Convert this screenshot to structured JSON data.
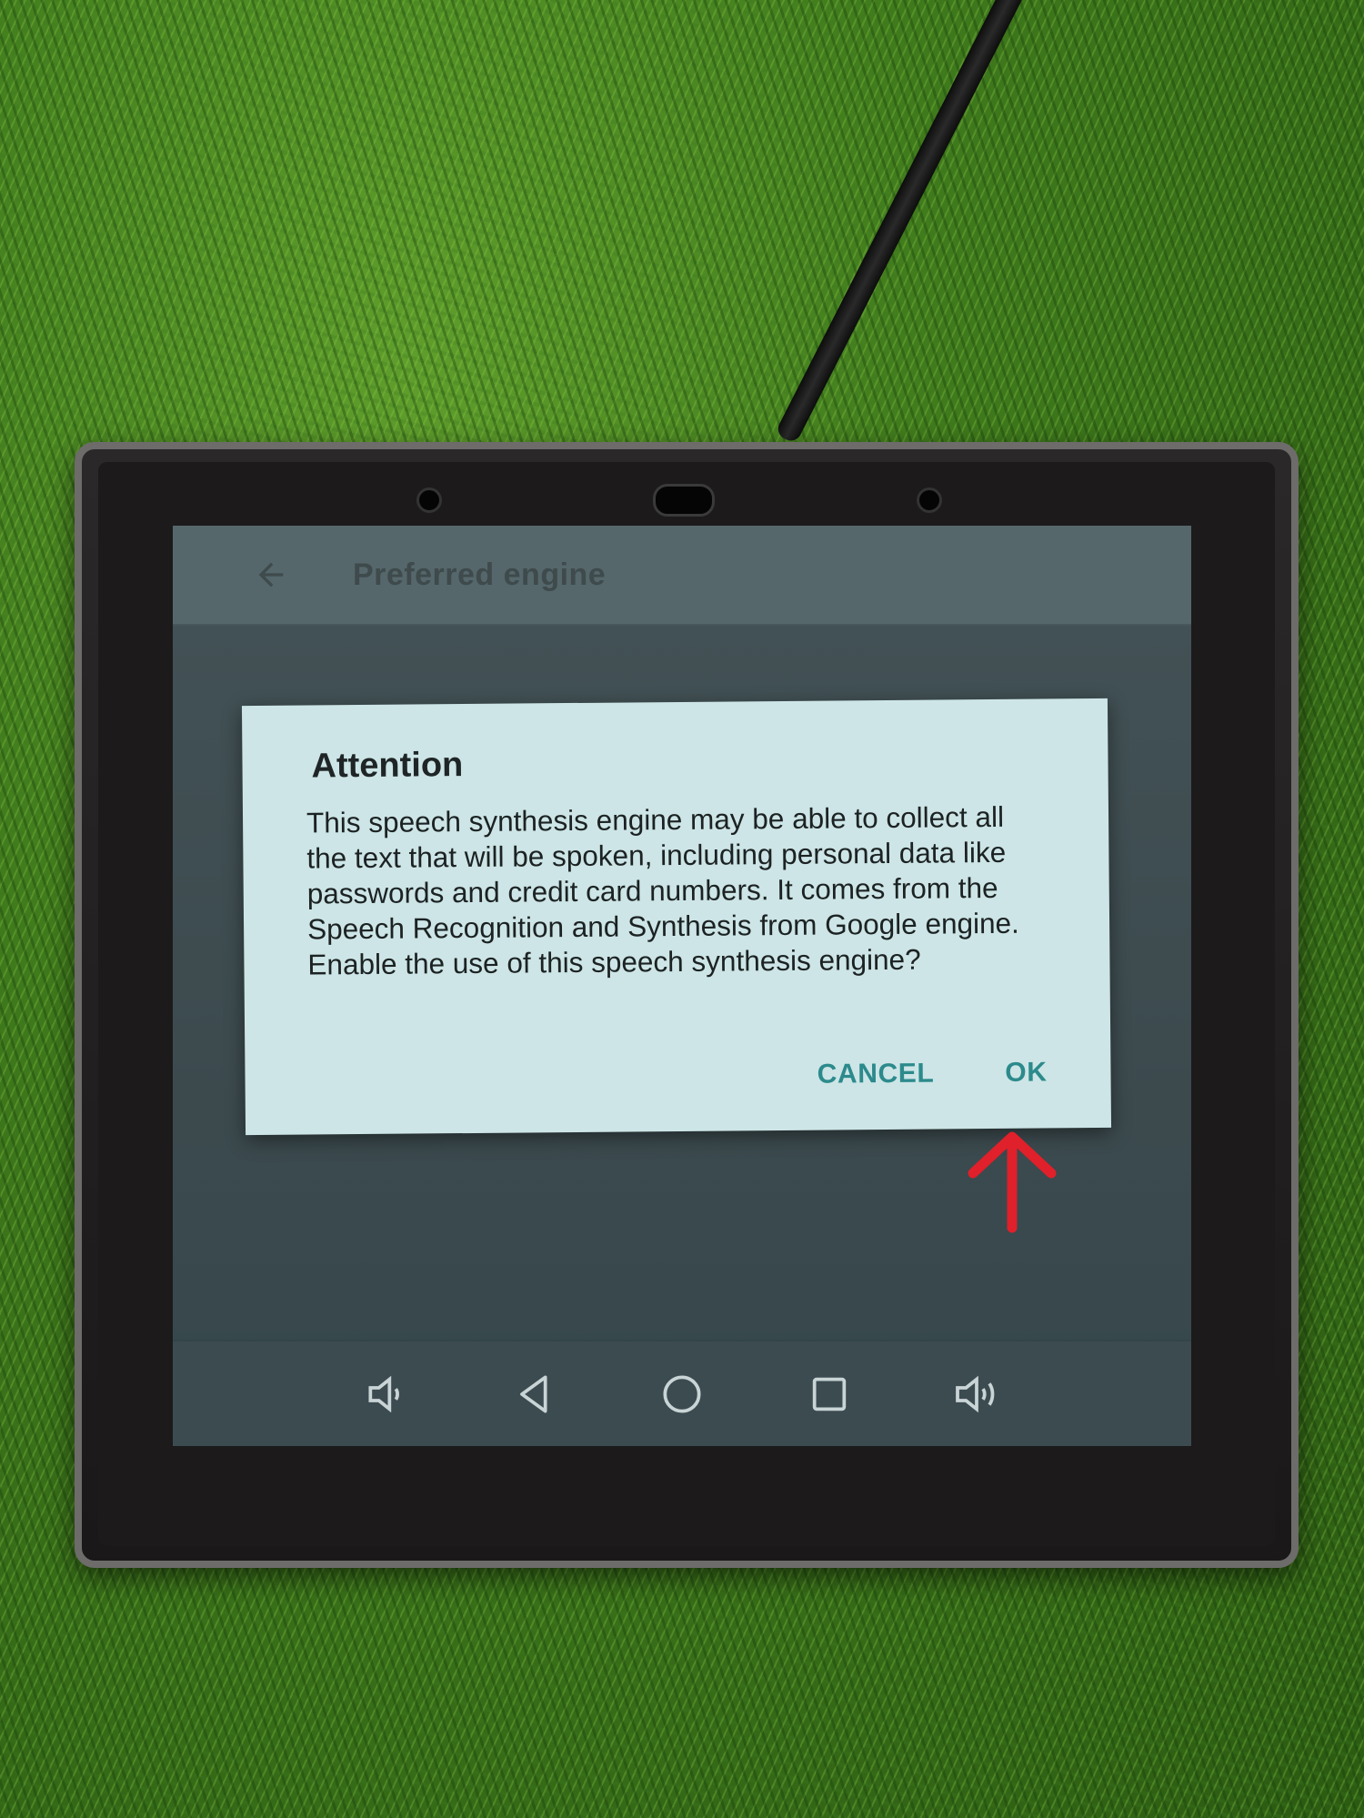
{
  "app_bar": {
    "title": "Preferred engine",
    "back_icon": "arrow-back-icon"
  },
  "dialog": {
    "title": "Attention",
    "message": "This speech synthesis engine may be able to collect all the text that will be spoken, including personal data like passwords and credit card numbers. It comes from the Speech Recognition and Synthesis from Google engine. Enable the use of this speech synthesis engine?",
    "cancel_label": "CANCEL",
    "ok_label": "OK",
    "accent_color": "#2c8a8c"
  },
  "nav_bar": {
    "items": [
      {
        "icon": "volume-down-icon"
      },
      {
        "icon": "back-triangle-icon"
      },
      {
        "icon": "home-circle-icon"
      },
      {
        "icon": "recents-square-icon"
      },
      {
        "icon": "volume-up-icon"
      }
    ]
  },
  "annotation": {
    "arrow_color": "#e0202a",
    "points_to": "ok-button"
  }
}
